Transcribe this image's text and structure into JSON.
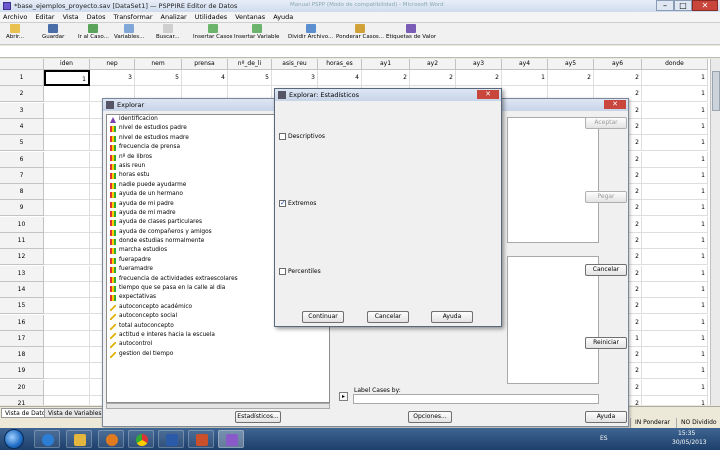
{
  "window": {
    "title": "*base_ejemplos_proyecto.sav [DataSet1] — PSPPIRE Editor de Datos",
    "ghost_title": "Manual PSPP (Modo de compatibilidad) - Microsoft Word"
  },
  "menu": [
    "Archivo",
    "Editar",
    "Vista",
    "Datos",
    "Transformar",
    "Analizar",
    "Utilidades",
    "Ventanas",
    "Ayuda"
  ],
  "toolbar": {
    "abrir": "Abrir...",
    "guardar": "Guardar",
    "ir_caso": "Ir al Caso...",
    "variables": "Variables...",
    "buscar": "Buscar...",
    "insertar_casos": "Insertar Casos",
    "insertar_variable": "Insertar Variable",
    "dividir": "Dividir Archivo...",
    "ponderar": "Ponderar Casos...",
    "etiquetas": "Etiquetas de Valor"
  },
  "grid": {
    "columns": [
      "iden",
      "nep",
      "nem",
      "prensa",
      "nº_de_li",
      "asis_reu",
      "horas_es",
      "ay1",
      "ay2",
      "ay3",
      "ay4",
      "ay5",
      "ay6",
      "donde"
    ],
    "rows": [
      "1",
      "2",
      "3",
      "4",
      "5",
      "6",
      "7",
      "8",
      "9",
      "10",
      "11",
      "12",
      "13",
      "14",
      "15",
      "16",
      "17",
      "18",
      "19",
      "20",
      "21"
    ],
    "row1": [
      "1",
      "3",
      "5",
      "4",
      "5",
      "3",
      "4",
      "2",
      "2",
      "2",
      "1",
      "2",
      "2",
      "1"
    ],
    "right_iden": [
      "2",
      "2",
      "2",
      "2",
      "2",
      "2",
      "2",
      "2",
      "2",
      "2",
      "2",
      "2",
      "2",
      "2",
      "2",
      "2",
      "1",
      "2",
      "2",
      "2",
      "2"
    ],
    "right_donde": [
      "1",
      "1",
      "1",
      "1",
      "1",
      "1",
      "1",
      "1",
      "1",
      "1",
      "1",
      "1",
      "1",
      "1",
      "1",
      "1",
      "1",
      "1",
      "1",
      "1",
      "1"
    ]
  },
  "tabs": {
    "data_view": "Vista de Datos",
    "variable_view": "Vista de Variables"
  },
  "status": {
    "weight": "IN Ponderar",
    "split": "NO Dividido"
  },
  "explorar": {
    "title": "Explorar",
    "variables": [
      {
        "icon": "id",
        "label": "identificacion"
      },
      {
        "icon": "bar",
        "label": "nivel de estudios padre"
      },
      {
        "icon": "bar",
        "label": "nivel de estudios madre"
      },
      {
        "icon": "bar",
        "label": "frecuencia de prensa"
      },
      {
        "icon": "bar",
        "label": "nº de libros"
      },
      {
        "icon": "bar",
        "label": "asis reun"
      },
      {
        "icon": "bar",
        "label": "horas estu"
      },
      {
        "icon": "bar",
        "label": "nadie puede ayudarme"
      },
      {
        "icon": "bar",
        "label": "ayuda de un hermano"
      },
      {
        "icon": "bar",
        "label": "ayuda de mi padre"
      },
      {
        "icon": "bar",
        "label": "ayuda de mi madre"
      },
      {
        "icon": "bar",
        "label": "ayuda de clases particulares"
      },
      {
        "icon": "bar",
        "label": "ayuda de compañeros y amigos"
      },
      {
        "icon": "bar",
        "label": "donde estudias normalmente"
      },
      {
        "icon": "bar",
        "label": "marcha estudios"
      },
      {
        "icon": "bar",
        "label": "fuerapadre"
      },
      {
        "icon": "bar",
        "label": "fueramadre"
      },
      {
        "icon": "bar",
        "label": "frecuencia de actividades extraescolares"
      },
      {
        "icon": "bar",
        "label": "tiempo que se pasa en la calle al dia"
      },
      {
        "icon": "bar",
        "label": "expectativas"
      },
      {
        "icon": "ruler",
        "label": "autoconcepto académico"
      },
      {
        "icon": "ruler",
        "label": "autoconcepto social"
      },
      {
        "icon": "ruler",
        "label": "total autoconcepto"
      },
      {
        "icon": "ruler",
        "label": "actitud e interes hacia la escuela"
      },
      {
        "icon": "ruler",
        "label": "autocontrol"
      },
      {
        "icon": "ruler",
        "label": "gestion del tiempo"
      }
    ],
    "buttons": {
      "aceptar": "Aceptar",
      "pegar": "Pegar",
      "cancelar": "Cancelar",
      "reiniciar": "Reiniciar",
      "ayuda": "Ayuda",
      "estadisticos": "Estadísticos...",
      "opciones": "Opciones..."
    },
    "label_cases": "Label Cases by:"
  },
  "estadisticos": {
    "title": "Explorar: Estadísticos",
    "options": [
      {
        "label": "Descriptivos",
        "checked": false
      },
      {
        "label": "Extremos",
        "checked": true
      },
      {
        "label": "Percentiles",
        "checked": false
      }
    ],
    "buttons": {
      "continuar": "Continuar",
      "cancelar": "Cancelar",
      "ayuda": "Ayuda"
    }
  },
  "taskbar": {
    "lang": "ES",
    "time": "15:35",
    "date": "30/05/2013"
  }
}
